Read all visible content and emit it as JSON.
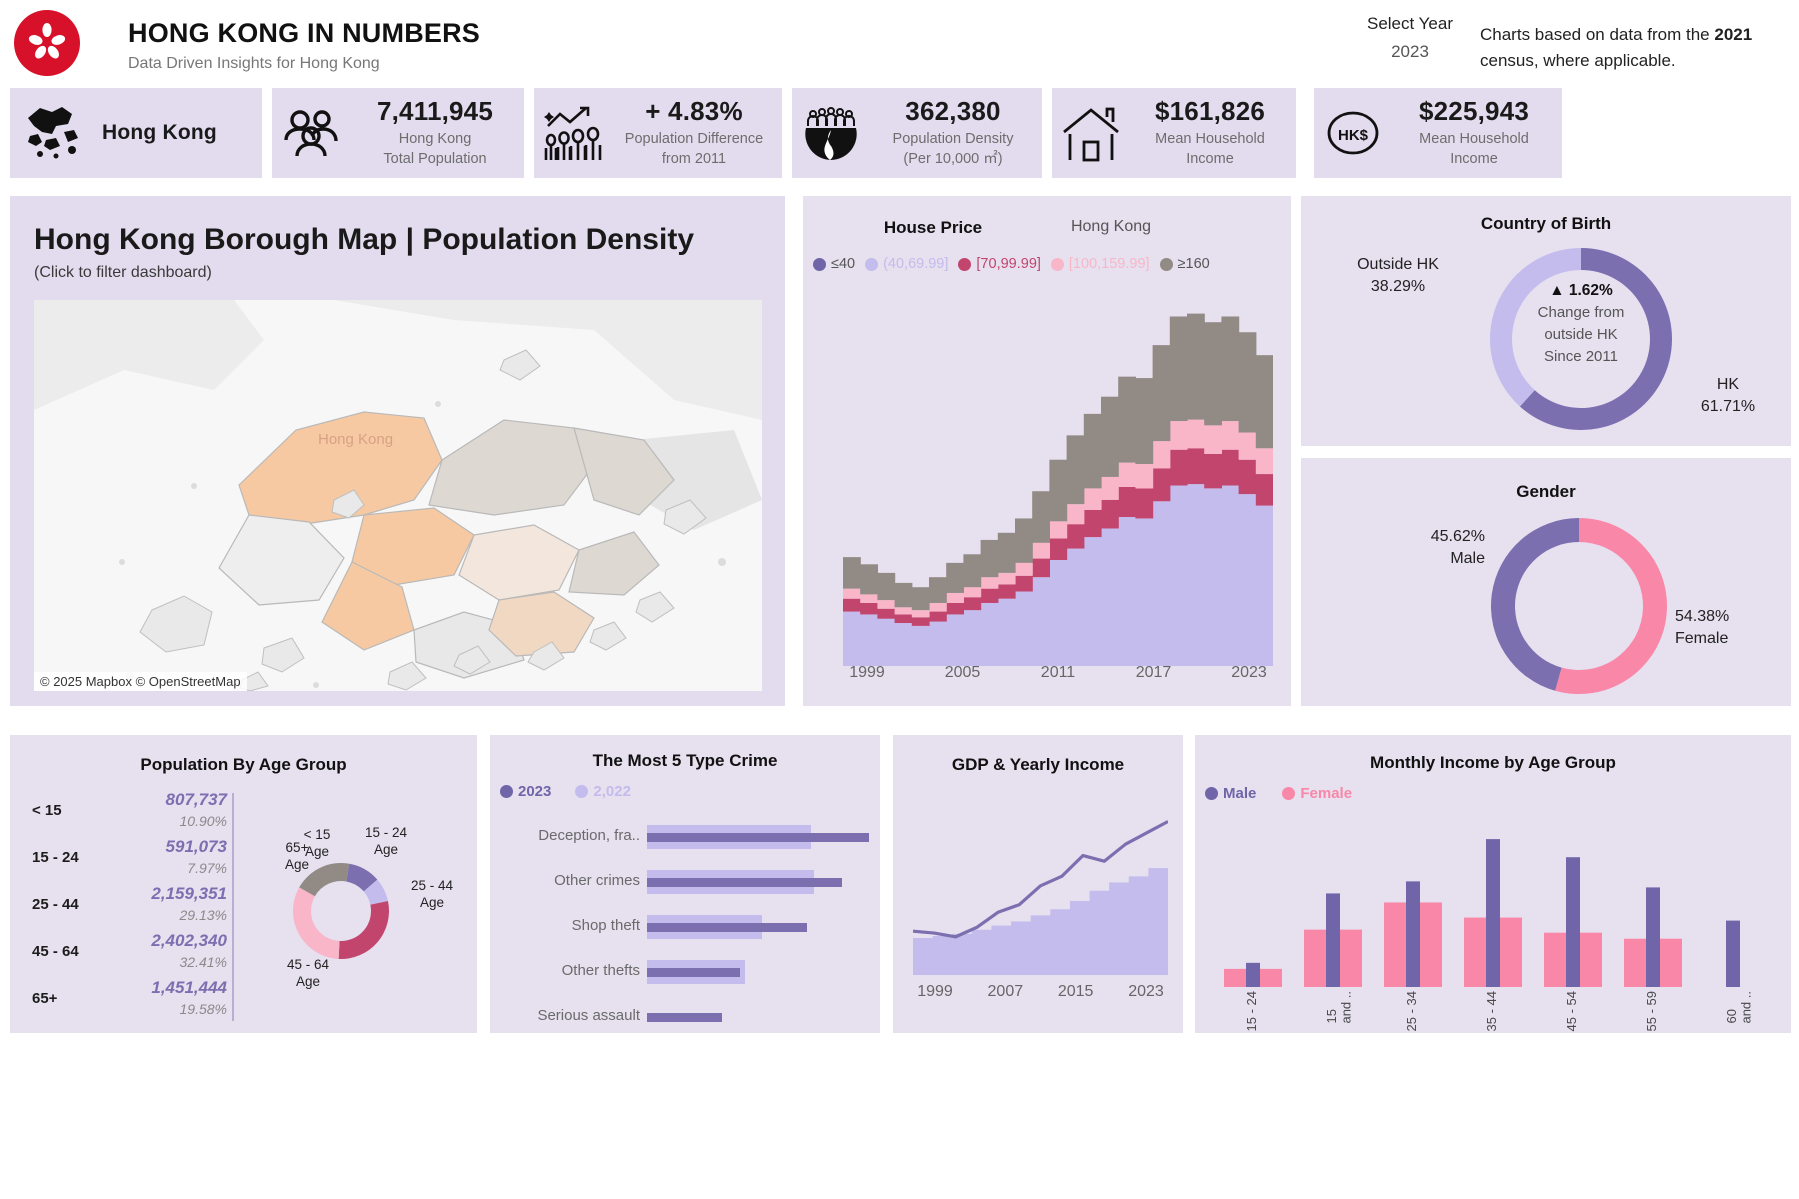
{
  "header": {
    "title": "HONG KONG IN NUMBERS",
    "subtitle": "Data Driven Insights for Hong Kong",
    "logo_icon": "hong-kong-bauhinia-icon",
    "year_selector_label": "Select Year",
    "year_selector_value": "2023",
    "note_line1": "Charts based on data from the",
    "note_year": "2021",
    "note_line2": " census, where applicable."
  },
  "kpis": [
    {
      "icon": "hong-kong-map-icon",
      "value": "Hong Kong",
      "caption": "",
      "type": "region"
    },
    {
      "icon": "people-group-icon",
      "value": "7,411,945",
      "caption": "Hong Kong\nTotal Population"
    },
    {
      "icon": "population-trend-icon",
      "value": "+ 4.83%",
      "caption": "Population Difference\nfrom 2011"
    },
    {
      "icon": "crowd-density-icon",
      "value": "362,380",
      "caption": "Population Density\n(Per 10,000 ㎡)"
    },
    {
      "icon": "house-icon",
      "value": "$161,826",
      "caption": "Mean Household\nIncome"
    },
    {
      "icon": "hkd-currency-icon",
      "value": "$225,943",
      "caption": "Mean Household\nIncome"
    }
  ],
  "map": {
    "title": "Hong Kong Borough Map | Population Density",
    "subtitle": "(Click to filter dashboard)",
    "attribution": "© 2025 Mapbox © OpenStreetMap",
    "place_label": "Hong Kong"
  },
  "house_price": {
    "title": "House Price",
    "subtitle": "Hong Kong",
    "legend": [
      {
        "label": "≤40",
        "color": "#6f65a8"
      },
      {
        "label": "(40,69.99]",
        "color": "#c3bcec"
      },
      {
        "label": "[70,99.99]",
        "color": "#c2456e"
      },
      {
        "label": "[100,159.99]",
        "color": "#f9b6c9"
      },
      {
        "label": "≥160",
        "color": "#918a85"
      }
    ]
  },
  "country_of_birth": {
    "title": "Country of Birth",
    "outside_label": "Outside HK",
    "outside_value": "38.29%",
    "hk_label": "HK",
    "hk_value": "61.71%",
    "center_change": "▲ 1.62%",
    "center_text": "Change from\noutside HK\nSince 2011",
    "colors": {
      "hk": "#7b6fb0",
      "outside": "#c3bcec"
    }
  },
  "gender": {
    "title": "Gender",
    "male_value": "45.62%",
    "male_label": "Male",
    "female_value": "54.38%",
    "female_label": "Female",
    "colors": {
      "male": "#7b6fb0",
      "female": "#f987a8"
    }
  },
  "age_group": {
    "title": "Population By Age Group",
    "rows": [
      {
        "label": "< 15",
        "value": "807,737",
        "pct": "10.90%"
      },
      {
        "label": "15 - 24",
        "value": "591,073",
        "pct": "7.97%"
      },
      {
        "label": "25 - 44",
        "value": "2,159,351",
        "pct": "29.13%"
      },
      {
        "label": "45 - 64",
        "value": "2,402,340",
        "pct": "32.41%"
      },
      {
        "label": "65+",
        "value": "1,451,444",
        "pct": "19.58%"
      }
    ],
    "donut_labels": [
      {
        "text": "< 15\nAge"
      },
      {
        "text": "15 - 24\nAge"
      },
      {
        "text": "25 - 44\nAge"
      },
      {
        "text": "45 - 64\nAge"
      },
      {
        "text": "65+\nAge"
      }
    ]
  },
  "crime": {
    "title": "The Most 5 Type Crime",
    "legend": [
      {
        "label": "2023",
        "color": "#6f65a8"
      },
      {
        "label": "2,022",
        "color": "#c3bcec"
      }
    ],
    "rows": [
      {
        "label": "Deception, fra..",
        "v2023": 100,
        "v2022": 74
      },
      {
        "label": "Other crimes",
        "v2023": 88,
        "v2022": 75
      },
      {
        "label": "Shop theft",
        "v2023": 72,
        "v2022": 52
      },
      {
        "label": "Other thefts",
        "v2023": 42,
        "v2022": 44
      },
      {
        "label": "Serious assault",
        "v2023": 34,
        "v2022": 0
      }
    ]
  },
  "gdp": {
    "title": "GDP & Yearly Income",
    "xticks": [
      "1999",
      "2007",
      "2015",
      "2023"
    ]
  },
  "income": {
    "title": "Monthly Income by Age Group",
    "legend": [
      {
        "label": "Male",
        "color": "#6f65a8"
      },
      {
        "label": "Female",
        "color": "#f987a8"
      }
    ],
    "xticks": [
      "15 - 24",
      "15\nand ..",
      "25 - 34",
      "35 - 44",
      "45 - 54",
      "55 - 59",
      "60\nand .."
    ]
  },
  "chart_data": [
    {
      "type": "area",
      "title": "House Price",
      "subtitle": "Hong Kong",
      "xlabel": "",
      "ylabel": "",
      "x": [
        1999,
        2000,
        2001,
        2002,
        2003,
        2004,
        2005,
        2006,
        2007,
        2008,
        2009,
        2010,
        2011,
        2012,
        2013,
        2014,
        2015,
        2016,
        2017,
        2018,
        2019,
        2020,
        2021,
        2022,
        2023
      ],
      "xticks": [
        "1999",
        "2005",
        "2011",
        "2017",
        "2023"
      ],
      "stacked": true,
      "series": [
        {
          "name": "≤40",
          "color": "#c3bcec",
          "values": [
            38,
            36,
            33,
            30,
            28,
            31,
            36,
            39,
            44,
            47,
            52,
            62,
            74,
            82,
            90,
            96,
            104,
            103,
            115,
            126,
            127,
            124,
            126,
            120,
            112
          ]
        },
        {
          "name": "(40,69.99]",
          "color": "#c3bcec",
          "values": [
            0,
            0,
            0,
            0,
            0,
            0,
            0,
            0,
            0,
            0,
            0,
            0,
            0,
            0,
            0,
            0,
            0,
            0,
            0,
            0,
            0,
            0,
            0,
            0,
            0
          ]
        },
        {
          "name": "[70,99.99]",
          "color": "#c2456e",
          "values": [
            9,
            8,
            7,
            6,
            6,
            7,
            8,
            9,
            10,
            10,
            11,
            13,
            15,
            17,
            19,
            20,
            21,
            21,
            23,
            25,
            25,
            24,
            25,
            24,
            22
          ]
        },
        {
          "name": "[100,159.99]",
          "color": "#f9b6c9",
          "values": [
            7,
            6,
            6,
            5,
            5,
            6,
            7,
            7,
            8,
            8,
            9,
            11,
            12,
            14,
            15,
            16,
            17,
            17,
            19,
            20,
            20,
            20,
            20,
            19,
            18
          ]
        },
        {
          "name": "≥160",
          "color": "#918a85",
          "values": [
            22,
            21,
            19,
            17,
            16,
            18,
            21,
            23,
            26,
            28,
            31,
            36,
            43,
            48,
            52,
            56,
            60,
            60,
            67,
            73,
            74,
            72,
            73,
            70,
            65
          ]
        }
      ]
    },
    {
      "type": "pie",
      "title": "Country of Birth",
      "labels": [
        "HK",
        "Outside HK"
      ],
      "values": [
        61.71,
        38.29
      ],
      "colors": [
        "#7b6fb0",
        "#c3bcec"
      ],
      "donut": true
    },
    {
      "type": "pie",
      "title": "Gender",
      "labels": [
        "Female",
        "Male"
      ],
      "values": [
        54.38,
        45.62
      ],
      "colors": [
        "#f987a8",
        "#7b6fb0"
      ],
      "donut": true
    },
    {
      "type": "pie",
      "title": "Population By Age Group",
      "labels": [
        "< 15 Age",
        "15 - 24 Age",
        "25 - 44 Age",
        "45 - 64 Age",
        "65+ Age"
      ],
      "values": [
        10.9,
        7.97,
        29.13,
        32.41,
        19.58
      ],
      "counts": [
        807737,
        591073,
        2159351,
        2402340,
        1451444
      ],
      "colors": [
        "#7b6fb0",
        "#c3bcec",
        "#c2456e",
        "#f9b6c9",
        "#918a85"
      ],
      "donut": true
    },
    {
      "type": "bar",
      "title": "The Most 5 Type Crime",
      "orientation": "horizontal",
      "categories": [
        "Deception, fra..",
        "Other crimes",
        "Shop theft",
        "Other thefts",
        "Serious assault"
      ],
      "series": [
        {
          "name": "2023",
          "color": "#6f65a8",
          "values": [
            100,
            88,
            72,
            42,
            34
          ]
        },
        {
          "name": "2,022",
          "color": "#c3bcec",
          "values": [
            74,
            75,
            52,
            44,
            0
          ]
        }
      ],
      "xlim": [
        0,
        100
      ]
    },
    {
      "type": "line",
      "title": "GDP & Yearly Income",
      "x": [
        1999,
        2001,
        2003,
        2005,
        2007,
        2009,
        2011,
        2013,
        2015,
        2017,
        2019,
        2021,
        2023
      ],
      "xticks": [
        "1999",
        "2007",
        "2015",
        "2023"
      ],
      "series": [
        {
          "name": "Yearly Income (line)",
          "color": "#7b6fb0",
          "values": [
            20,
            19,
            17,
            22,
            30,
            34,
            44,
            49,
            60,
            57,
            66,
            72,
            78
          ]
        },
        {
          "name": "GDP (area)",
          "color": "#c3bcec",
          "values": [
            18,
            19,
            20,
            22,
            24,
            26,
            29,
            32,
            36,
            41,
            45,
            48,
            52
          ]
        }
      ]
    },
    {
      "type": "bar",
      "title": "Monthly Income by Age Group",
      "categories": [
        "15 - 24",
        "15 and ..",
        "25 - 34",
        "35 - 44",
        "45 - 54",
        "55 - 59",
        "60 and .."
      ],
      "series": [
        {
          "name": "Male",
          "color": "#6f65a8",
          "values": [
            16,
            62,
            70,
            98,
            86,
            66,
            44
          ]
        },
        {
          "name": "Female",
          "color": "#f987a8",
          "values": [
            12,
            38,
            56,
            46,
            36,
            32,
            0
          ]
        }
      ]
    }
  ]
}
